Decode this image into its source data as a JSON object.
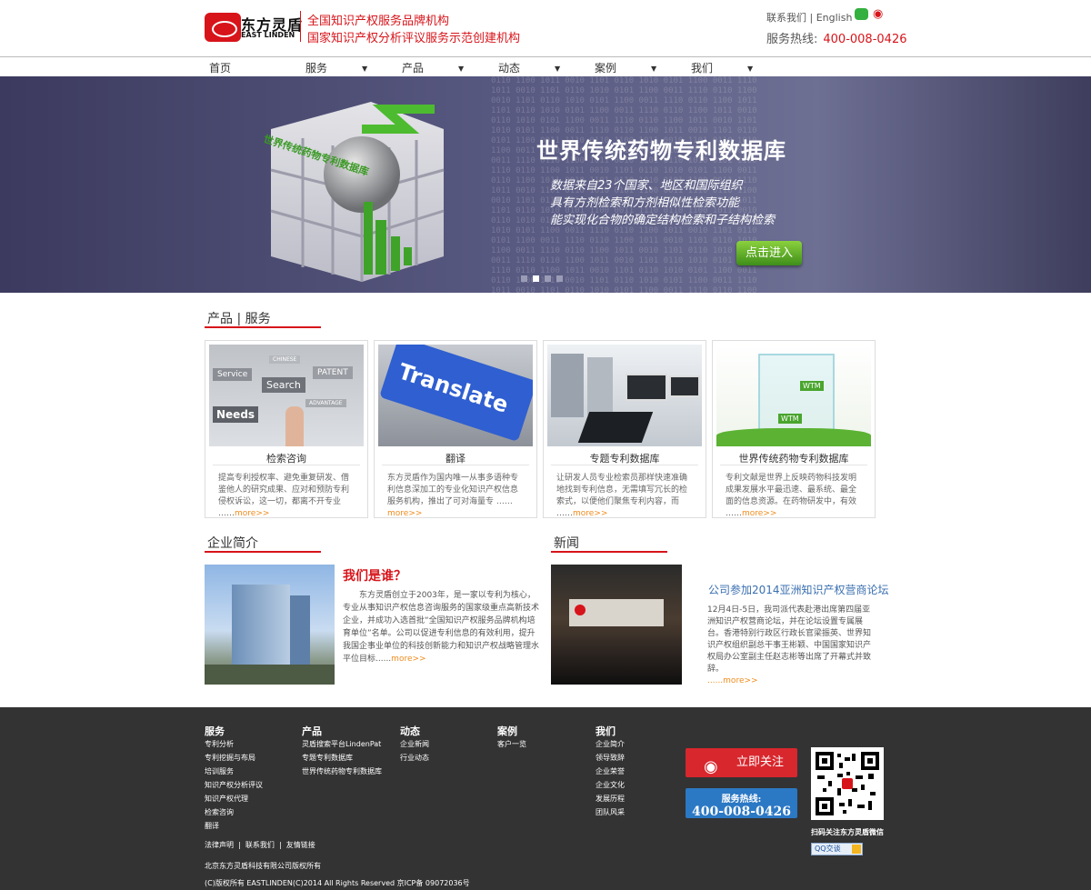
{
  "header": {
    "logo_cn": "东方灵盾",
    "logo_en": "EAST LINDEN",
    "slogan_line1": "全国知识产权服务品牌机构",
    "slogan_line2": "国家知识产权分析评议服务示范创建机构",
    "contact_link": "联系我们",
    "lang_link": "English",
    "hotline_label": "服务热线:",
    "hotline_number": "400-008-0426"
  },
  "nav": {
    "items": [
      {
        "label": "首页",
        "has_dropdown": false
      },
      {
        "label": "服务",
        "has_dropdown": true
      },
      {
        "label": "产品",
        "has_dropdown": true
      },
      {
        "label": "动态",
        "has_dropdown": true
      },
      {
        "label": "案例",
        "has_dropdown": true
      },
      {
        "label": "我们",
        "has_dropdown": true
      }
    ]
  },
  "banner": {
    "title": "世界传统药物专利数据库",
    "lines": [
      "数据来自23个国家、地区和国际组织",
      "具有方剂检索和方剂相似性检索功能",
      "能实现化合物的确定结构检索和子结构检索"
    ],
    "cta": "点击进入",
    "cube_label": "世界传统药物专利数据库",
    "slide_count": 4,
    "active_slide": 2
  },
  "products": {
    "heading": "产品 | 服务",
    "cards": [
      {
        "name": "检索咨询",
        "desc": "提高专利授权率、避免重复研发、借鉴他人的研究成果、应对和预防专利侵权诉讼，这一切，都离不开专业 ……",
        "more": "more>>",
        "img_words": [
          "Service",
          "Search",
          "PATENT",
          "CHINESE",
          "ADVANTAGE",
          "Needs"
        ]
      },
      {
        "name": "翻译",
        "desc": "东方灵盾作为国内唯一从事多语种专利信息深加工的专业化知识产权信息服务机构，推出了可对海量专 ……",
        "more": "more>>",
        "img_words": [
          "Translate"
        ]
      },
      {
        "name": "专题专利数据库",
        "desc": "让研发人员专业检索员那样快速准确地找到专利信息，无需填写冗长的检索式，以便他们聚焦专利内容，而 ……",
        "more": "more>>",
        "img_words": []
      },
      {
        "name": "世界传统药物专利数据库",
        "desc": "专利文献是世界上反映药物科技发明成果发展水平最迅速、最系统、最全面的信息资源。在药物研发中，有效 ……",
        "more": "more>>",
        "img_words": [
          "WTM",
          "WTM"
        ]
      }
    ]
  },
  "intro": {
    "heading": "企业简介",
    "title": "我们是谁？",
    "text": "东方灵盾创立于2003年，是一家以专利为核心，专业从事知识产权信息咨询服务的国家级重点高新技术企业，并成功入选首批“全国知识产权服务品牌机构培育单位”名单。公司以促进专利信息的有效利用，提升我国企事业单位的科技创新能力和知识产权战略管理水平位目标......",
    "more": "more>>"
  },
  "news": {
    "heading": "新闻",
    "title": "公司参加2014亚洲知识产权营商论坛",
    "text": "12月4日-5日，我司派代表赴港出席第四届亚洲知识产权营商论坛，并在论坛设置专属展台。香港特别行政区行政长官梁振英、世界知识产权组织副总干事王彬颖、中国国家知识产权局办公室副主任赵志彬等出席了开幕式并致辞。",
    "more": "......more>>"
  },
  "footer": {
    "columns": [
      {
        "title": "服务",
        "items": [
          "专利分析",
          "专利挖掘与布局",
          "培训服务",
          "知识产权分析评议",
          "知识产权代理",
          "检索咨询",
          "翻译"
        ]
      },
      {
        "title": "产品",
        "items": [
          "灵盾搜索平台LindenPat",
          "专题专利数据库",
          "世界传统药物专利数据库"
        ]
      },
      {
        "title": "动态",
        "items": [
          "企业新闻",
          "行业动态"
        ]
      },
      {
        "title": "案例",
        "items": [
          "客户一览"
        ]
      },
      {
        "title": "我们",
        "items": [
          "企业简介",
          "领导致辞",
          "企业荣誉",
          "企业文化",
          "发展历程",
          "团队风采"
        ]
      }
    ],
    "links": [
      "法律声明",
      "联系我们",
      "友情链接"
    ],
    "company": "北京东方灵盾科技有限公司版权所有",
    "copyright": "(C)版权所有  EASTLINDEN(C)2014 All Rights Reserved 京ICP备 09072036号",
    "follow_label": "立即关注",
    "service_label": "服务热线:",
    "service_number": "400-008-0426",
    "qr_caption": "扫码关注东方灵盾微信",
    "qq_label": "QQ交谈"
  },
  "colors": {
    "brand_red": "#d7141a",
    "footer_bg": "#333333",
    "service_blue": "#2b78c4",
    "more_orange": "#f08c1e"
  }
}
